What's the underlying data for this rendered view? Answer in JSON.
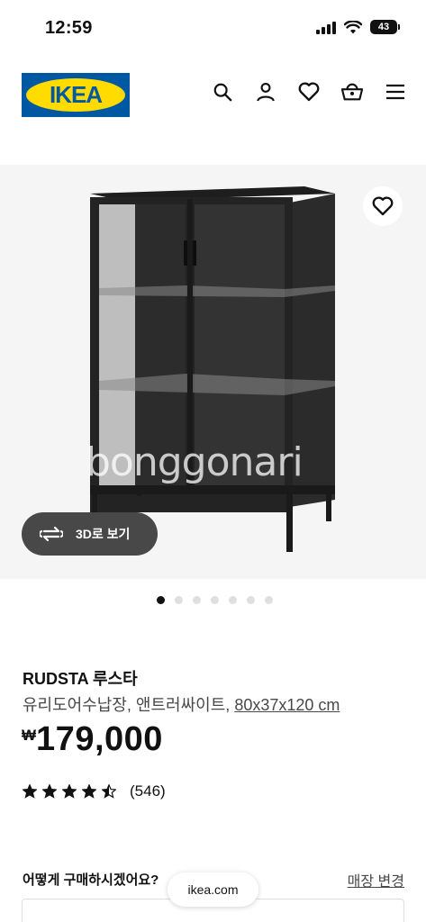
{
  "status": {
    "time": "12:59",
    "battery": "43"
  },
  "header": {
    "logo_text": "IKEA",
    "icons": [
      "search-icon",
      "account-icon",
      "wishlist-icon",
      "cart-icon",
      "menu-icon"
    ]
  },
  "media": {
    "watermark": "bonggonari",
    "view3d_label": "3D로 보기",
    "carousel_count": 7,
    "carousel_active": 0
  },
  "product": {
    "name": "RUDSTA 루스타",
    "description": "유리도어수납장, 앤트러싸이트,",
    "dimensions": "80x37x120 cm",
    "currency": "₩",
    "price": "179,000",
    "rating": 4.5,
    "review_count": "(546)"
  },
  "purchase": {
    "title": "어떻게 구매하시겠어요?",
    "store_link": "매장 변경"
  },
  "browser": {
    "url": "ikea.com"
  },
  "colors": {
    "ikea_blue": "#0058a3",
    "ikea_yellow": "#ffdb00",
    "pill_gray": "#484848"
  }
}
